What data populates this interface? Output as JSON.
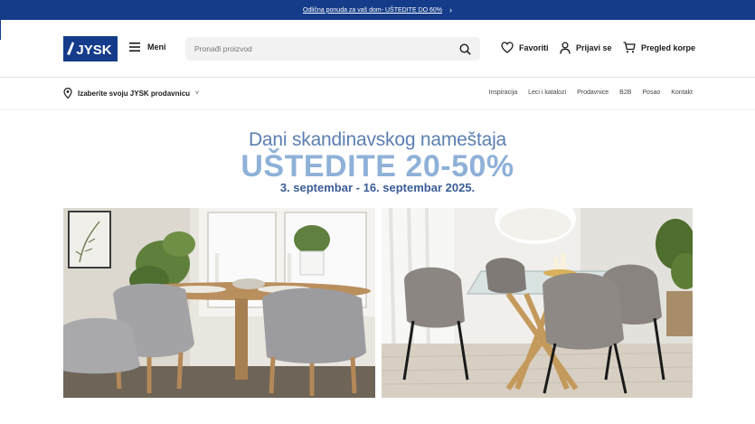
{
  "promo": {
    "text": "Odlična ponuda za vaš dom- UŠTEDITE DO 60%"
  },
  "header": {
    "logo_text": "JYSK",
    "menu_label": "Meni",
    "search_placeholder": "Pronađi proizvod",
    "favorites_label": "Favoriti",
    "login_label": "Prijavi se",
    "cart_label": "Pregled korpe"
  },
  "subnav": {
    "store_label": "Izaberite svoju JYSK prodavnicu",
    "links": [
      "Inspiracija",
      "Leci i katalozi",
      "Prodavnice",
      "B2B",
      "Posao",
      "Kontakt"
    ]
  },
  "hero": {
    "subtitle": "Dani skandinavskog nameštaja",
    "title": "UŠTEDITE 20-50%",
    "dates": "3. septembar - 16. septembar 2025."
  },
  "colors": {
    "brand": "#143c8a",
    "hero_light": "#8fb1d8",
    "hero_mid": "#5b7fb1",
    "hero_dark": "#3a5c98"
  }
}
